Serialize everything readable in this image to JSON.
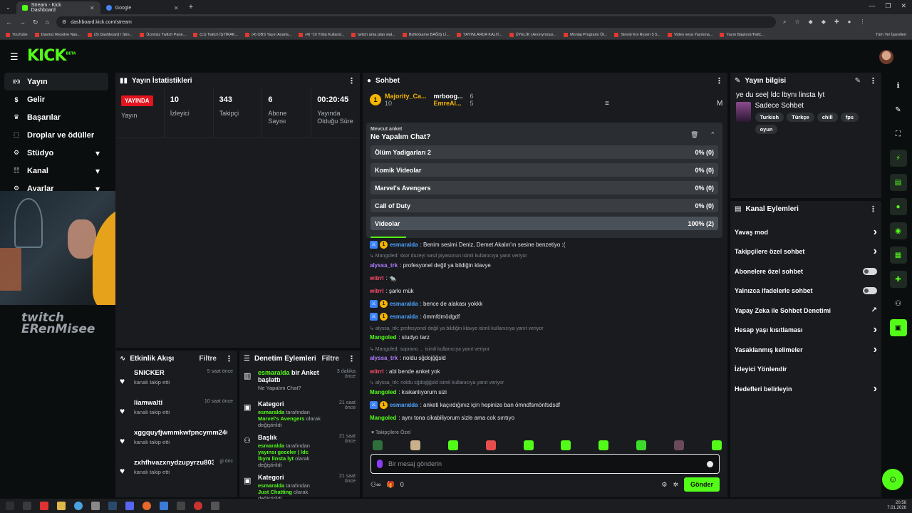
{
  "browser": {
    "tabs": [
      {
        "title": "Stream - Kick Dashboard",
        "favicon_color": "#53fc18",
        "active": true
      },
      {
        "title": "Google",
        "favicon_color": "#4285f4",
        "active": false
      }
    ],
    "url": "dashboard.kick.com/stream",
    "bookmarks": [
      "YouTube",
      "Davinci Resolve Nas...",
      "(3) Dashboard / Stre...",
      "Ücretsiz Twitch Pane...",
      "(11) Twitch İŞTİRAK...",
      "(4) OBS Yayın Ayarla...",
      "(4) \"10 Yılda Kulland...",
      "twitch arka plan wal...",
      "ByNoGame BAĞIŞ Lİ...",
      "YAYINLARDA KALIT...",
      "ÜYELİK | Anonymous...",
      "Montaj Programı Öl...",
      "Sinerji Koi Ryzen 5 5...",
      "Video veya Yayınına...",
      "Yayın Başlıyor/Twitc..."
    ],
    "all_bookmarks": "Tüm Yer İşaretleri"
  },
  "brand": {
    "logo": "KICK",
    "beta": "BETA",
    "accent": "#53fc18"
  },
  "sidebar": {
    "items": [
      {
        "label": "Yayın",
        "icon": "broadcast-icon",
        "active": true,
        "chevron": false
      },
      {
        "label": "Gelir",
        "icon": "money-icon",
        "active": false,
        "chevron": false
      },
      {
        "label": "Başarılar",
        "icon": "trophy-icon",
        "active": false,
        "chevron": false
      },
      {
        "label": "Droplar ve ödüller",
        "icon": "gift-icon",
        "active": false,
        "chevron": false
      },
      {
        "label": "Stüdyo",
        "icon": "gear-icon",
        "active": false,
        "chevron": true
      },
      {
        "label": "Kanal",
        "icon": "channel-icon",
        "active": false,
        "chevron": true
      },
      {
        "label": "Ayarlar",
        "icon": "settings-icon",
        "active": false,
        "chevron": true
      }
    ]
  },
  "overlay": {
    "line1": "twitch",
    "line2": "ERenMisee"
  },
  "stats": {
    "title": "Yayın İstatistikleri",
    "live_badge": "YAYINDA",
    "items": [
      {
        "value": "",
        "label": "Yayın"
      },
      {
        "value": "10",
        "label": "İzleyici"
      },
      {
        "value": "343",
        "label": "Takipçi"
      },
      {
        "value": "6",
        "label": "Abone Sayısı"
      },
      {
        "value": "00:20:45",
        "label": "Yayında Olduğu Süre"
      }
    ]
  },
  "activity": {
    "title": "Etkinlik Akışı",
    "filter": "Filtre",
    "items": [
      {
        "name": "SNICKER",
        "sub": "kanalı takip etti",
        "time": "5 saat önce"
      },
      {
        "name": "liamwalti",
        "sub": "kanalı takip etti",
        "time": "10 saat önce"
      },
      {
        "name": "xggquyfjwmmkwfpncymm246",
        "sub": "kanalı takip etti",
        "time": ""
      },
      {
        "name": "zxhfhvazxnydzupyrzu8033",
        "sub": "kanalı takip etti",
        "time": "gi önc"
      }
    ]
  },
  "moderation": {
    "title": "Denetim Eylemleri",
    "filter": "Filtre",
    "items": [
      {
        "icon": "poll-icon",
        "title_user": "esmaralda",
        "title_rest": " bir Anket başlattı",
        "sub_user": "",
        "sub_text": "Ne Yapalım Chat?",
        "sub_highlight": "",
        "sub_tail": "",
        "time": "3 dakika önce"
      },
      {
        "icon": "category-icon",
        "title_user": "",
        "title_rest": "Kategori",
        "sub_user": "esmaralda",
        "sub_text": " tarafından ",
        "sub_highlight": "Marvel's Avengers",
        "sub_tail": " olarak değiştirildi",
        "time": "21 saat önce"
      },
      {
        "icon": "title-icon",
        "title_user": "",
        "title_rest": "Başlık",
        "sub_user": "esmaralda",
        "sub_text": " tarafından ",
        "sub_highlight": "yayınsı geceler | ldc lbynı linsta lyt",
        "sub_tail": " olarak değiştirildi",
        "time": "21 saat önce"
      },
      {
        "icon": "category-icon",
        "title_user": "",
        "title_rest": "Kategori",
        "sub_user": "esmaralda",
        "sub_text": " tarafından ",
        "sub_highlight": "Just Chatting",
        "sub_tail": " olarak değiştirildi",
        "time": "21 saat önce"
      }
    ]
  },
  "chat": {
    "title": "Sohbet",
    "pinned": [
      {
        "badge": "1",
        "name": "Majority_Ca...",
        "count": "10"
      },
      {
        "badge": "",
        "name": "mrboog...",
        "count": "6"
      },
      {
        "badge": "",
        "name": "EmreAl...",
        "count": "5"
      }
    ],
    "poll": {
      "caption": "Mevcut anket",
      "question": "Ne Yapalım Chat?",
      "options": [
        {
          "label": "Ölüm Yadigarları 2",
          "result": "0% (0)",
          "share": 0
        },
        {
          "label": "Komik Videolar",
          "result": "0% (0)",
          "share": 0
        },
        {
          "label": "Marvel's Avengers",
          "result": "0% (0)",
          "share": 0
        },
        {
          "label": "Call of Duty",
          "result": "0% (0)",
          "share": 0
        },
        {
          "label": "Videolar",
          "result": "100% (2)",
          "share": 1
        }
      ],
      "time_remaining": 0.1
    },
    "messages": [
      {
        "type": "msg",
        "badges": 2,
        "user": "esmaralda",
        "color": "#4fa3ff",
        "text": ": Benim sesimi Deniz, Demet Akalın'ın sesine benzetiyo :("
      },
      {
        "type": "reply",
        "text": "↳ Mangoled: skor duzeyi nasil piyasonun isimli kullanıcıya yanıt veriyor"
      },
      {
        "type": "msg",
        "badges": 0,
        "user": "alyssa_trk",
        "color": "#b57cff",
        "text": ": profesyonel değil ya bildiğin klavye"
      },
      {
        "type": "msg",
        "badges": 0,
        "user": "witrrl",
        "color": "#ff4d6d",
        "text": ": 🐀"
      },
      {
        "type": "msg",
        "badges": 0,
        "user": "witrrl",
        "color": "#ff4d6d",
        "text": ": şarkı mük"
      },
      {
        "type": "msg",
        "badges": 2,
        "user": "esmaralda",
        "color": "#4fa3ff",
        "text": ": bence de alakası yokkk"
      },
      {
        "type": "msg",
        "badges": 2,
        "user": "esmaralda",
        "color": "#4fa3ff",
        "text": ": ömmfdmödgdf"
      },
      {
        "type": "reply",
        "text": "↳ alyssa_trk: profesyonel değil ya bildiğin klavye isimli kullanıcıya yanıt veriyor"
      },
      {
        "type": "msg",
        "badges": 0,
        "user": "Mangoled",
        "color": "#53fc18",
        "text": ": studyo tarz"
      },
      {
        "type": "reply",
        "text": "↳ Mangoled: soprano ... isimli kullanıcıya yanıt veriyor"
      },
      {
        "type": "msg",
        "badges": 0,
        "user": "alyssa_trk",
        "color": "#b57cff",
        "text": ": noldu sğdojğğsld"
      },
      {
        "type": "msg",
        "badges": 0,
        "user": "witrrl",
        "color": "#ff4d6d",
        "text": ": abi bende anket yok"
      },
      {
        "type": "reply",
        "text": "↳ alyssa_trk: noldu sğdojğğsld isimli kullanıcıya yanıt veriyor"
      },
      {
        "type": "msg",
        "badges": 0,
        "user": "Mangoled",
        "color": "#53fc18",
        "text": ": kıskanlıyorum sizi"
      },
      {
        "type": "msg",
        "badges": 2,
        "user": "esmaralda",
        "color": "#4fa3ff",
        "text": ": anketi kaçırdığınız için hepinize ban ömndfsmönfsdsdf"
      },
      {
        "type": "msg",
        "badges": 0,
        "user": "Mangoled",
        "color": "#53fc18",
        "text": ": aynı tona cikabiliyorum sizle ama cok sırıtıyo"
      }
    ],
    "followers_only": "Takipçilere Özel",
    "emote_colors": [
      "#2f6f3a",
      "#c9b08a",
      "#53fc18",
      "#e84d4d",
      "#53fc18",
      "#53fc18",
      "#53fc18",
      "#3cdc2a",
      "#6a4a5a",
      "#53fc18"
    ],
    "input_placeholder": "Bir mesaj gönderin",
    "gift_count": "0",
    "send_label": "Gönder"
  },
  "stream_info": {
    "title": "Yayın bilgisi",
    "stream_title": "ye du see| ldc lbynı linsta lyt",
    "category": "Sadece Sohbet",
    "tags": [
      "Turkish",
      "Türkçe",
      "chill",
      "fps",
      "oyun"
    ]
  },
  "channel_actions": {
    "title": "Kanal Eylemleri",
    "items": [
      {
        "label": "Yavaş mod",
        "control": "chevron"
      },
      {
        "label": "Takipçilere özel sohbet",
        "control": "chevron"
      },
      {
        "label": "Abonelere özel sohbet",
        "control": "toggle"
      },
      {
        "label": "Yalnızca ifadelerle sohbet",
        "control": "toggle"
      },
      {
        "label": "Yapay Zeka ile Sohbet Denetimi",
        "control": "external"
      },
      {
        "label": "Hesap yaşı kısıtlaması",
        "control": "chevron"
      },
      {
        "label": "Yasaklanmış kelimeler",
        "control": "chevron"
      },
      {
        "label": "İzleyici Yönlendir",
        "control": "none"
      },
      {
        "label": "Hedefleri belirleyin",
        "control": "chevron"
      }
    ]
  },
  "clock": {
    "time": "20:58",
    "date": "7.01.2026"
  }
}
